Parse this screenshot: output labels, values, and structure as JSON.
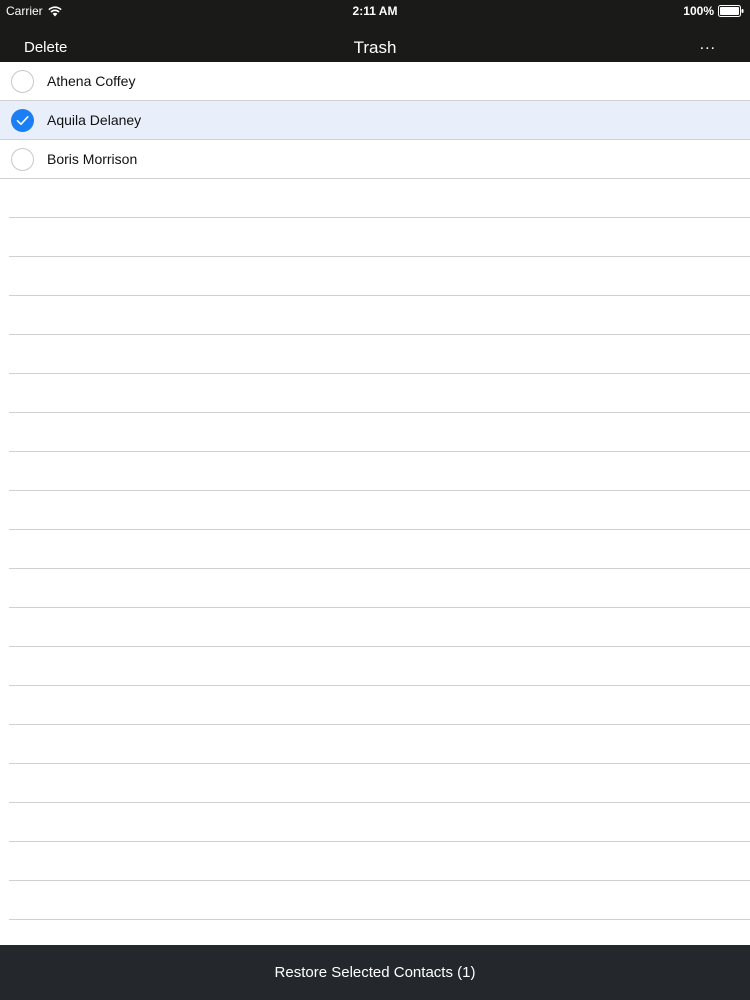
{
  "status_bar": {
    "carrier": "Carrier",
    "time": "2:11 AM",
    "battery": "100%",
    "wifi_icon": "wifi-icon",
    "battery_icon": "battery-icon"
  },
  "nav_bar": {
    "left_button": "Delete",
    "title": "Trash",
    "right_button": "..."
  },
  "contacts": [
    {
      "name": "Athena Coffey",
      "selected": false
    },
    {
      "name": "Aquila Delaney",
      "selected": true
    },
    {
      "name": "Boris Morrison",
      "selected": false
    }
  ],
  "toolbar": {
    "restore_label": "Restore Selected Contacts (1)"
  },
  "colors": {
    "header_bg": "#1a1b18",
    "toolbar_bg": "#24272b",
    "accent": "#1a7ef5",
    "selected_row_bg": "#e8eefa"
  }
}
